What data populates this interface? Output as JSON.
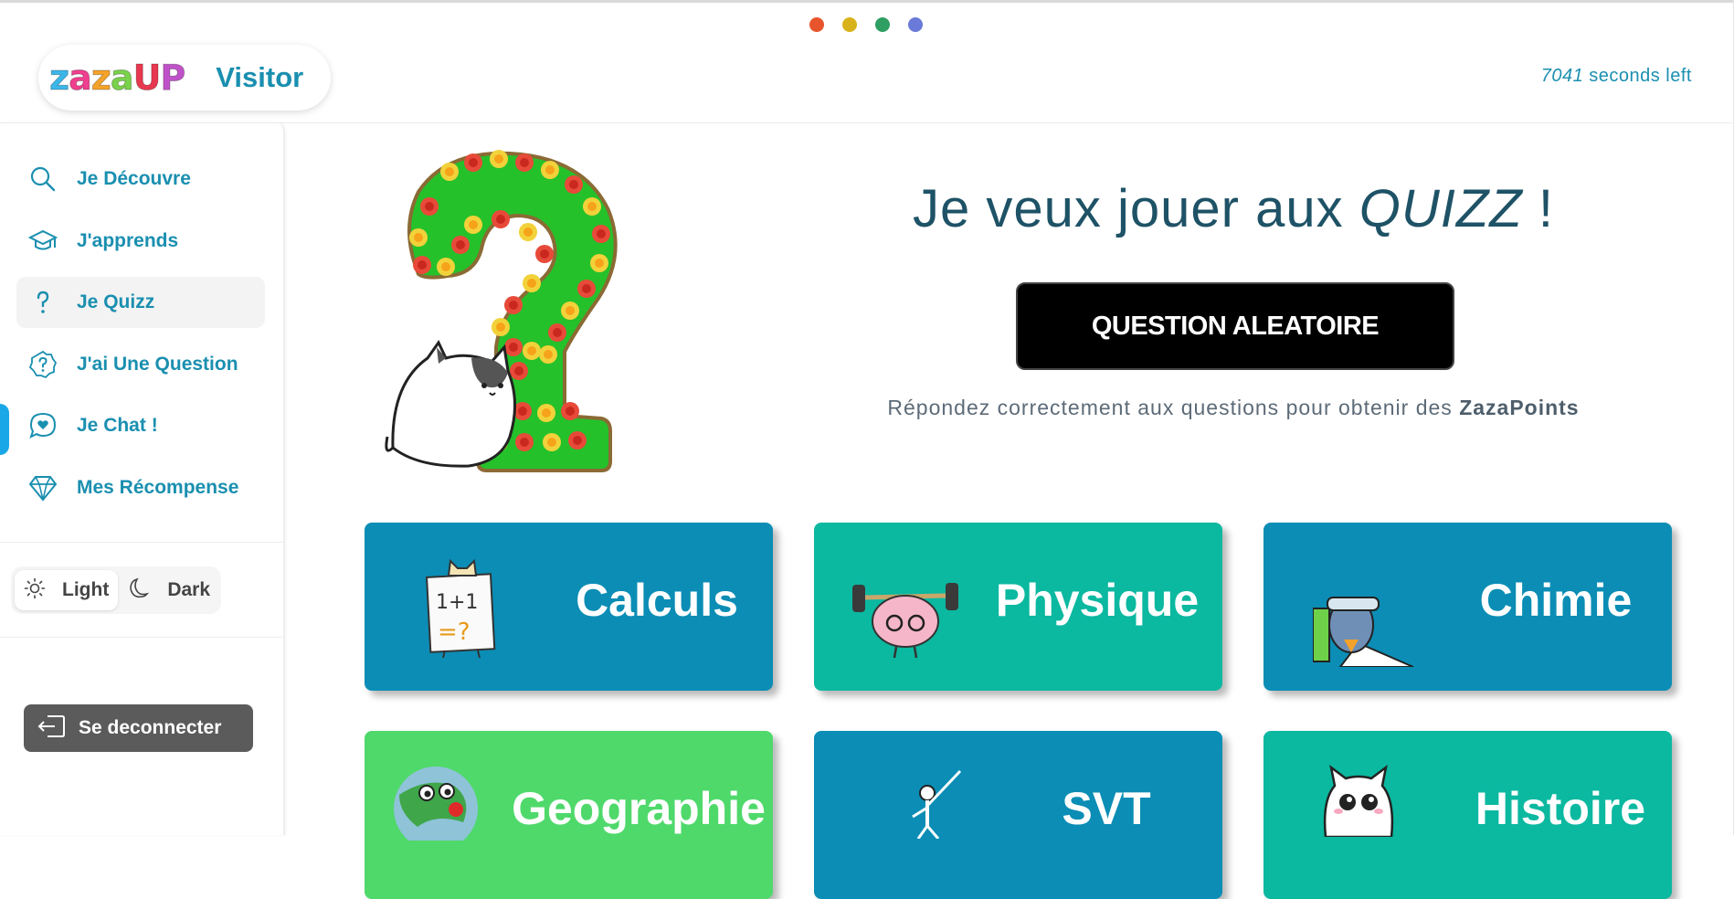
{
  "header": {
    "dots": [
      "#e8542c",
      "#d8b21a",
      "#2e9e62",
      "#6a7ad8"
    ],
    "logo_letters": [
      {
        "ch": "z",
        "color": "#3bb6e8"
      },
      {
        "ch": "a",
        "color": "#ef3f8e"
      },
      {
        "ch": "z",
        "color": "#f4a22b"
      },
      {
        "ch": "a",
        "color": "#7ad14b"
      },
      {
        "ch": "U",
        "color": "#e8384f"
      },
      {
        "ch": "P",
        "color": "#c052c9"
      }
    ],
    "visitor_label": "Visitor",
    "timer_value": "7041",
    "timer_suffix": " seconds left"
  },
  "sidebar": {
    "items": [
      {
        "label": "Je Découvre",
        "icon": "search-icon"
      },
      {
        "label": "J'apprends",
        "icon": "graduation-cap-icon"
      },
      {
        "label": "Je Quizz",
        "icon": "question-mark-icon"
      },
      {
        "label": "J'ai Une Question",
        "icon": "question-badge-icon"
      },
      {
        "label": "Je Chat !",
        "icon": "chat-heart-icon"
      },
      {
        "label": "Mes Récompense",
        "icon": "diamond-icon"
      }
    ],
    "active_index": 2,
    "theme": {
      "light": "Light",
      "dark": "Dark",
      "selected": "light"
    },
    "logout_label": "Se deconnecter"
  },
  "main": {
    "title_prefix": "Je veux jouer aux ",
    "title_em": "QUIZZ",
    "title_suffix": " !",
    "random_button": "QUESTION ALEATOIRE",
    "subtitle_prefix": "Répondez correctement aux questions pour obtenir des ",
    "subtitle_bold": "ZazaPoints",
    "categories": [
      {
        "name": "Calculs",
        "color": "#0b8db5",
        "art": "cat-math-sign"
      },
      {
        "name": "Physique",
        "color": "#0bb8a0",
        "art": "brain-weights"
      },
      {
        "name": "Chimie",
        "color": "#0b8db5",
        "art": "chemist-bird"
      },
      {
        "name": "Geographie",
        "color": "#4fd96b",
        "art": "globe"
      },
      {
        "name": "SVT",
        "color": "#0b8db5",
        "art": "skeleton"
      },
      {
        "name": "Histoire",
        "color": "#0bb8a0",
        "art": "cat-historian"
      }
    ]
  }
}
